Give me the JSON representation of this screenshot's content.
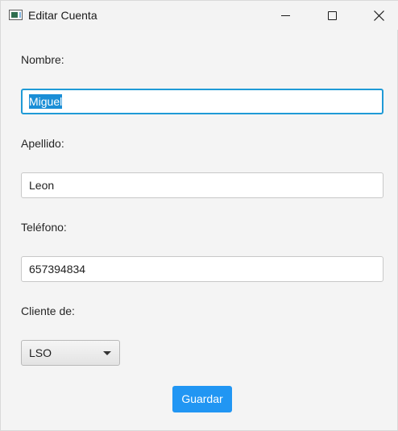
{
  "window": {
    "title": "Editar Cuenta",
    "icons": {
      "app": "app-window-icon",
      "minimize": "minimize-icon",
      "maximize": "maximize-icon",
      "close": "close-icon"
    }
  },
  "form": {
    "nombre_label": "Nombre:",
    "nombre_value": "Miguel",
    "apellido_label": "Apellido:",
    "apellido_value": "Leon",
    "telefono_label": "Teléfono:",
    "telefono_value": "657394834",
    "cliente_label": "Cliente de:",
    "cliente_value": "LSO",
    "save_label": "Guardar"
  },
  "colors": {
    "accent": "#2196f3",
    "focus_border": "#1f9ad6",
    "selection": "#1a8ed6"
  }
}
